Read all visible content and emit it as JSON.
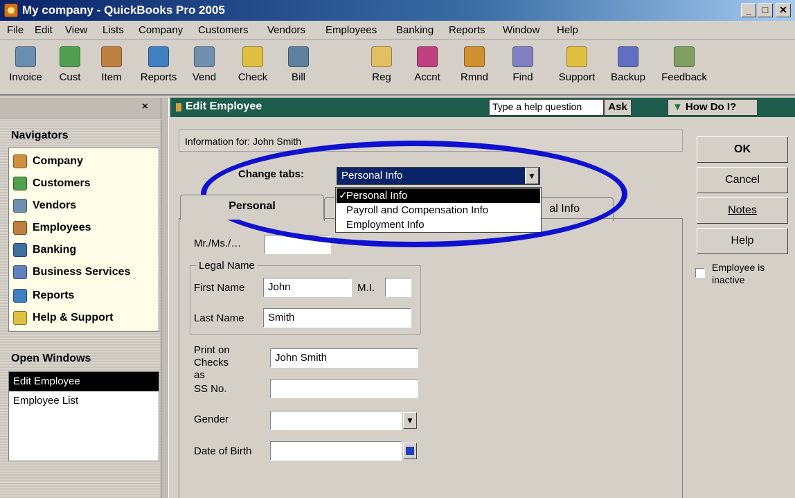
{
  "window": {
    "title": "My company - QuickBooks Pro 2005",
    "controls": [
      "_",
      "□",
      "✕"
    ]
  },
  "menu": [
    "File",
    "Edit",
    "View",
    "Lists",
    "Company",
    "Customers",
    "Vendors",
    "Employees",
    "Banking",
    "Reports",
    "Window",
    "Help"
  ],
  "toolbar": [
    {
      "label": "Invoice",
      "icon": "invoice-icon",
      "color": "#6a8fb0"
    },
    {
      "label": "Cust",
      "icon": "customer-icon",
      "color": "#50a050"
    },
    {
      "label": "Item",
      "icon": "item-icon",
      "color": "#c08040"
    },
    {
      "label": "Reports",
      "icon": "reports-icon",
      "color": "#4080c0"
    },
    {
      "label": "Vend",
      "icon": "vendor-icon",
      "color": "#7090b0"
    },
    {
      "label": "Check",
      "icon": "check-icon",
      "color": "#e0c040"
    },
    {
      "label": "Bill",
      "icon": "bill-icon",
      "color": "#6080a0"
    },
    {
      "label": "Reg",
      "icon": "register-icon",
      "color": "#e0c060"
    },
    {
      "label": "Accnt",
      "icon": "account-icon",
      "color": "#c04080"
    },
    {
      "label": "Rmnd",
      "icon": "reminder-icon",
      "color": "#d09030"
    },
    {
      "label": "Find",
      "icon": "find-icon",
      "color": "#8080c0"
    },
    {
      "label": "Support",
      "icon": "support-icon",
      "color": "#e0c040"
    },
    {
      "label": "Backup",
      "icon": "backup-icon",
      "color": "#6070c0"
    },
    {
      "label": "Feedback",
      "icon": "feedback-icon",
      "color": "#80a060"
    }
  ],
  "navpane": {
    "close": "×",
    "navigators_heading": "Navigators",
    "items": [
      {
        "label": "Company",
        "icon": "company-icon",
        "color": "#d09040"
      },
      {
        "label": "Customers",
        "icon": "customers-icon",
        "color": "#50a050"
      },
      {
        "label": "Vendors",
        "icon": "vendors-icon",
        "color": "#7090b0"
      },
      {
        "label": "Employees",
        "icon": "employees-icon",
        "color": "#c08040"
      },
      {
        "label": "Banking",
        "icon": "banking-icon",
        "color": "#4070a0"
      },
      {
        "label": "Business Services",
        "icon": "business-services-icon",
        "color": "#6080c0"
      },
      {
        "label": "Reports",
        "icon": "reports-icon",
        "color": "#4080c0"
      },
      {
        "label": "Help & Support",
        "icon": "help-support-icon",
        "color": "#e0c040"
      }
    ],
    "open_windows_heading": "Open Windows",
    "open_windows": [
      "Edit Employee",
      "Employee List"
    ]
  },
  "editbar": {
    "title": "Edit Employee",
    "help_placeholder": "Type a help question",
    "ask": "Ask",
    "how_do_i": "How Do I?"
  },
  "form": {
    "info_for": "Information for: John Smith",
    "change_tabs_label": "Change tabs:",
    "change_tabs_value": "Personal Info",
    "dropdown_options": [
      "Personal Info",
      "Payroll and Compensation Info",
      "Employment Info"
    ],
    "dropdown_selected_mark": "✓",
    "tabs": [
      "Personal",
      "al Info"
    ],
    "salutation_label": "Mr./Ms./…",
    "legal_name_label": "Legal Name",
    "first_name_label": "First Name",
    "first_name_value": "John",
    "mi_label": "M.I.",
    "last_name_label": "Last Name",
    "last_name_value": "Smith",
    "print_on_checks_label": "Print on Checks as",
    "print_on_checks_value": "John Smith",
    "ssn_label": "SS No.",
    "gender_label": "Gender",
    "dob_label": "Date of Birth"
  },
  "buttons": {
    "ok": "OK",
    "cancel": "Cancel",
    "notes": "Notes",
    "help": "Help"
  },
  "inactive_label": "Employee is inactive",
  "annotation_color": "#1010d0"
}
